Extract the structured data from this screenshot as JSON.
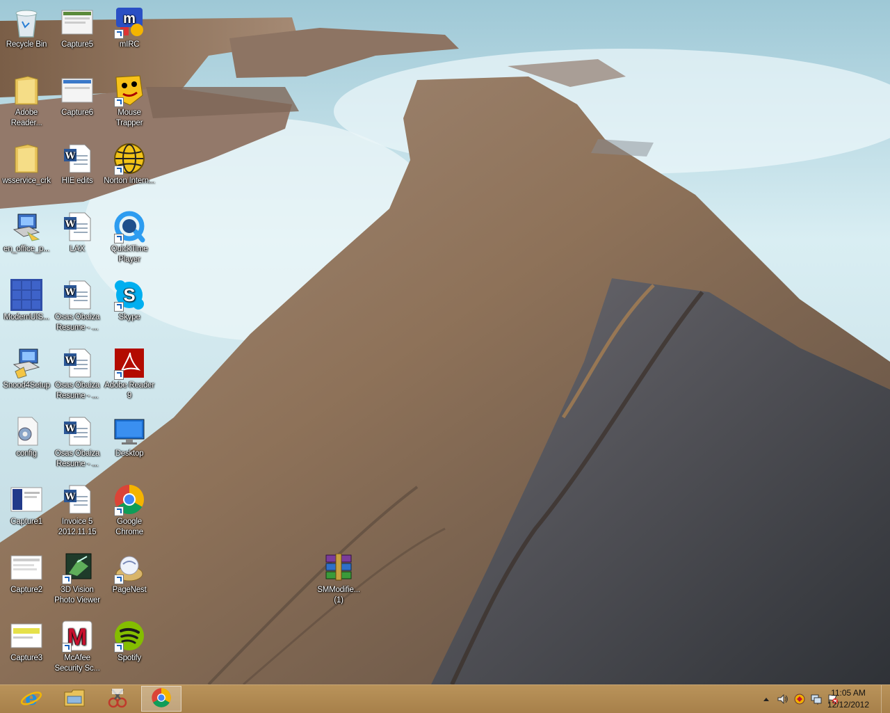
{
  "desktop": {
    "icons": [
      {
        "label": "Recycle Bin",
        "icon": "recycle-bin-icon"
      },
      {
        "label": "Capture5",
        "icon": "screenshot-image-icon"
      },
      {
        "label": "mIRC",
        "icon": "mirc-icon"
      },
      {
        "label": "Adobe Reader...",
        "icon": "folder-icon"
      },
      {
        "label": "Capture6",
        "icon": "screenshot-image-icon"
      },
      {
        "label": "Mouse Trapper",
        "icon": "mouse-trapper-icon"
      },
      {
        "label": "wsservice_crk",
        "icon": "folder-icon"
      },
      {
        "label": "HIE edits",
        "icon": "word-document-icon"
      },
      {
        "label": "Norton Intern...",
        "icon": "norton-globe-icon"
      },
      {
        "label": "en_office_p...",
        "icon": "installer-icon"
      },
      {
        "label": "LAX",
        "icon": "word-document-icon"
      },
      {
        "label": "QuickTime Player",
        "icon": "quicktime-icon"
      },
      {
        "label": "ModernUIS...",
        "icon": "modern-ui-tiles-icon"
      },
      {
        "label": "Osas Obaiza Resume - ...",
        "icon": "word-document-icon"
      },
      {
        "label": "Skype",
        "icon": "skype-icon"
      },
      {
        "label": "Snood4Setup",
        "icon": "installer-icon"
      },
      {
        "label": "Osas Obaiza Resume - ...",
        "icon": "word-document-icon"
      },
      {
        "label": "Adobe Reader 9",
        "icon": "adobe-reader-icon"
      },
      {
        "label": "config",
        "icon": "config-settings-icon"
      },
      {
        "label": "Osas Obaiza Resume - ...",
        "icon": "word-document-icon"
      },
      {
        "label": "Desktop",
        "icon": "desktop-monitor-icon"
      },
      {
        "label": "Capture1",
        "icon": "screenshot-image-icon"
      },
      {
        "label": "Invoice 5 2012.11.15",
        "icon": "word-document-icon"
      },
      {
        "label": "Google Chrome",
        "icon": "chrome-icon"
      },
      {
        "label": "Capture2",
        "icon": "screenshot-image-icon"
      },
      {
        "label": "3D Vision Photo Viewer",
        "icon": "3d-vision-icon"
      },
      {
        "label": "PageNest",
        "icon": "pagenest-icon"
      },
      {
        "label": "Capture3",
        "icon": "screenshot-image-icon"
      },
      {
        "label": "McAfee Security Sc...",
        "icon": "mcafee-icon"
      },
      {
        "label": "Spotify",
        "icon": "spotify-icon"
      },
      {
        "label": "SMModifie... (1)",
        "icon": "winrar-archive-icon"
      }
    ]
  },
  "taskbar": {
    "pinned": [
      {
        "name": "internet-explorer",
        "icon": "internet-explorer-icon",
        "active": false
      },
      {
        "name": "file-explorer",
        "icon": "file-explorer-icon",
        "active": false
      },
      {
        "name": "snipping-tool",
        "icon": "snipping-tool-icon",
        "active": false
      },
      {
        "name": "google-chrome",
        "icon": "chrome-icon",
        "active": true
      }
    ],
    "tray": {
      "icons": [
        "show-hidden-icons-arrow",
        "volume-icon",
        "mcafee-shield-icon",
        "network-icon",
        "action-center-flag-icon"
      ]
    },
    "clock": {
      "time": "11:05 AM",
      "date": "12/12/2012"
    }
  },
  "colors": {
    "taskbar": "#ad8850",
    "chrome_active_bg": "rgba(255,255,255,0.28)"
  }
}
